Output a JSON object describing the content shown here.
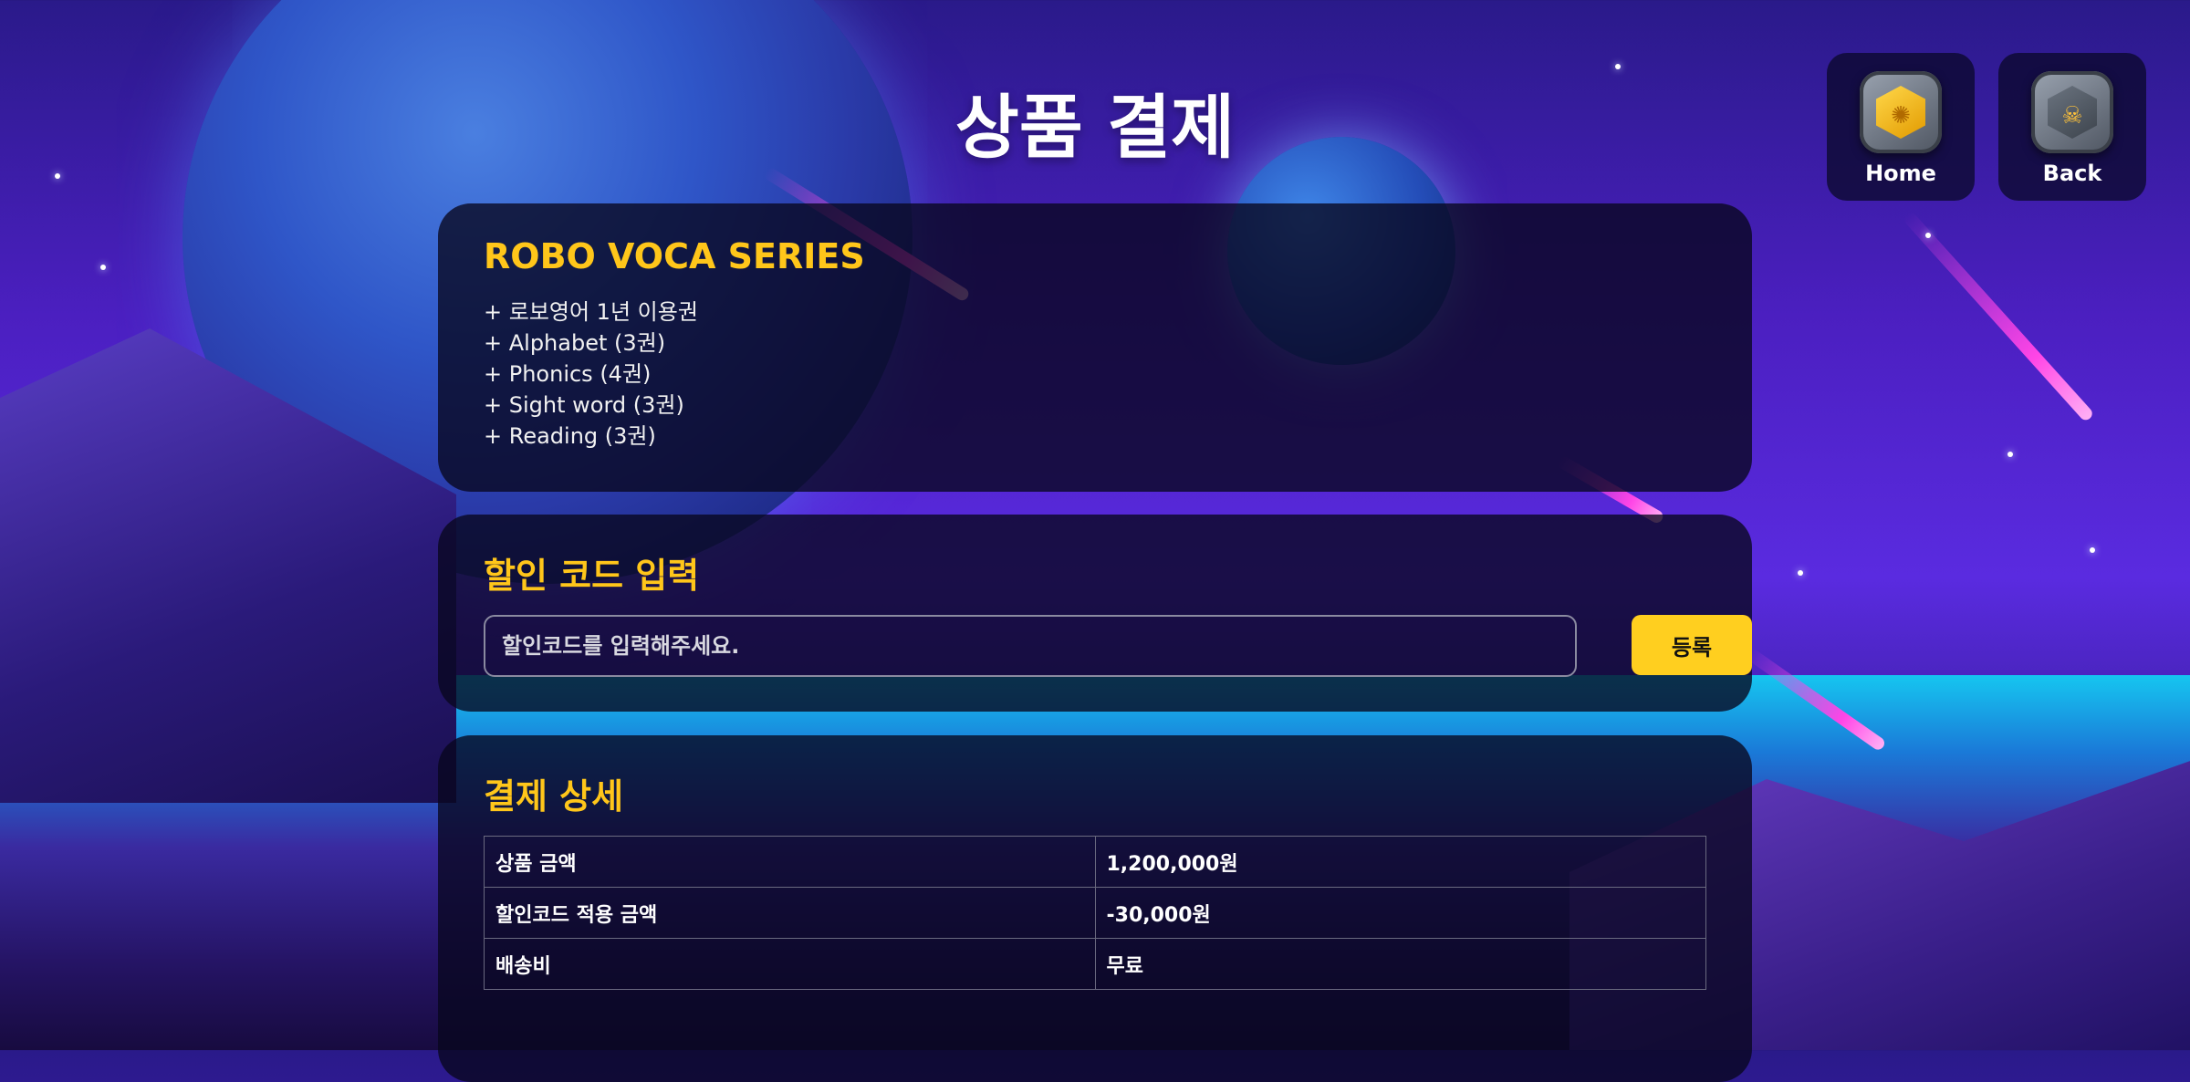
{
  "page": {
    "title": "상품 결제"
  },
  "nav": {
    "home_label": "Home",
    "back_label": "Back"
  },
  "product": {
    "title": "ROBO VOCA SERIES",
    "features": [
      "+ 로보영어 1년 이용권",
      "+ Alphabet (3권)",
      "+ Phonics (4권)",
      "+ Sight word (3권)",
      "+ Reading (3권)"
    ]
  },
  "coupon": {
    "title": "할인 코드 입력",
    "placeholder": "할인코드를 입력해주세요.",
    "submit_label": "등록"
  },
  "payment": {
    "title": "결제 상세",
    "rows": [
      {
        "label": "상품 금액",
        "value": "1,200,000원"
      },
      {
        "label": "할인코드 적용 금액",
        "value": "-30,000원"
      },
      {
        "label": "배송비",
        "value": "무료"
      }
    ]
  },
  "colors": {
    "accent": "#ffc61a",
    "button": "#ffcf1f",
    "panel_bg": "rgba(8,6,30,0.78)"
  },
  "icons": {
    "home": "gold-gem-badge-icon",
    "back": "skull-badge-icon"
  }
}
